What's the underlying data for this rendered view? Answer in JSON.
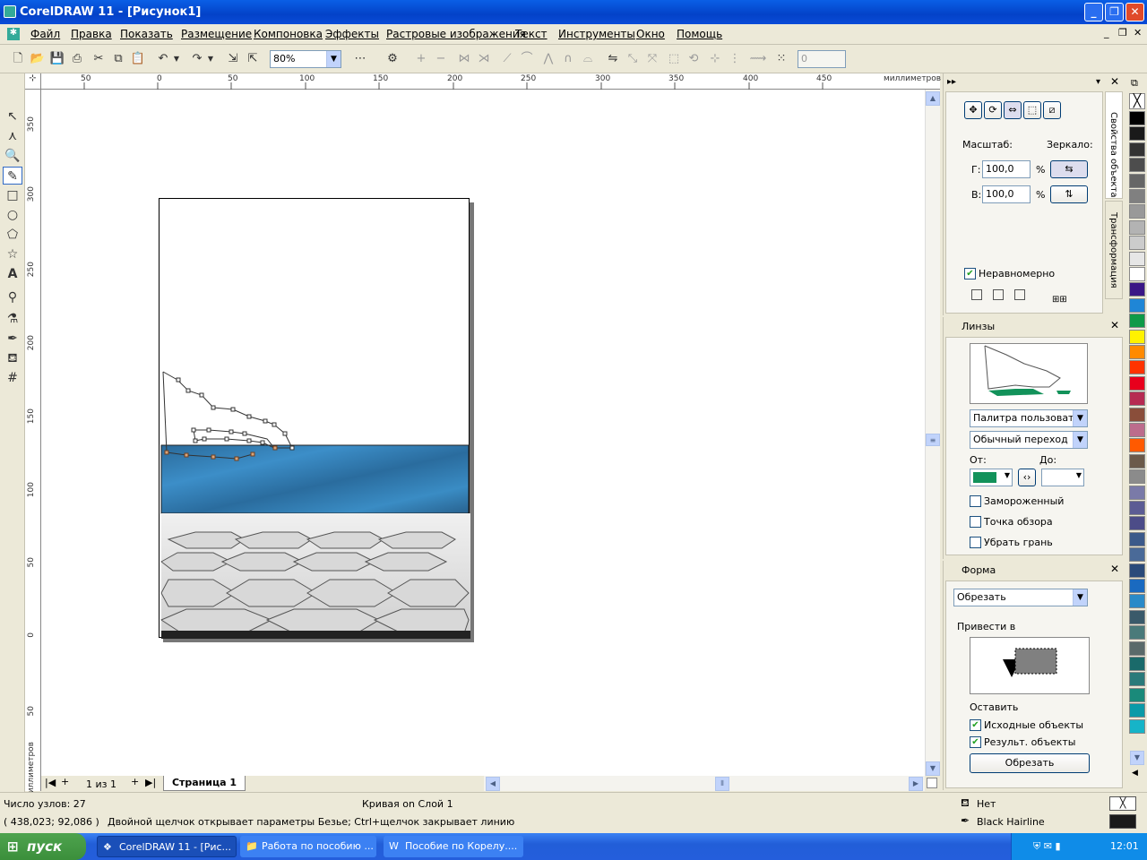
{
  "window": {
    "title": "CorelDRAW 11 - [Рисунок1]"
  },
  "menu": [
    "Файл",
    "Правка",
    "Показать",
    "Размещение",
    "Компоновка",
    "Эффекты",
    "Растровые изображения",
    "Текст",
    "Инструменты",
    "Окно",
    "Помощь"
  ],
  "toolbar": {
    "zoom": "80%",
    "nudge": "0"
  },
  "ruler": {
    "h_ticks": [
      "50",
      "0",
      "50",
      "100",
      "150",
      "200",
      "250",
      "300",
      "350",
      "400",
      "450"
    ],
    "h_unit": "миллиметров",
    "v_ticks": [
      "350",
      "300",
      "250",
      "200",
      "150",
      "100",
      "50",
      "0",
      "50"
    ],
    "v_unit": "миллиметров"
  },
  "pagenav": {
    "count": "1 из 1",
    "tab": "Страница 1"
  },
  "docker_obj": {
    "scale_label": "Масштаб:",
    "mirror_label": "Зеркало:",
    "h_label": "Г:",
    "h_value": "100,0",
    "v_label": "В:",
    "v_value": "100,0",
    "pct": "%",
    "nonprop": "Неравномерно",
    "tab1": "Свойства объекта",
    "tab2": "Трансформация"
  },
  "lens": {
    "title": "Линзы",
    "palette": "Палитра пользоват...",
    "transition": "Обычный переход",
    "from": "От:",
    "to": "До:",
    "frozen": "Замороженный",
    "viewpoint": "Точка обзора",
    "remove_face": "Убрать грань",
    "from_color": "#12925a"
  },
  "shape": {
    "title": "Форма",
    "mode": "Обрезать",
    "apply_to": "Привести в",
    "leave": "Оставить",
    "src": "Исходные объекты",
    "result": "Результ. объекты",
    "button": "Обрезать"
  },
  "status": {
    "nodes": "Число узлов: 27",
    "object": "Кривая on Слой 1",
    "coords": "( 438,023; 92,086 )",
    "hint": "Двойной щелчок открывает параметры Безье; Ctrl+щелчок закрывает линию",
    "fill": "Нет",
    "outline": "Black  Hairline"
  },
  "taskbar": {
    "start": "пуск",
    "tasks": [
      "CorelDRAW 11 - [Рис...",
      "Работа по пособию ...",
      "Пособие по Корелу...."
    ],
    "lang": "EN",
    "time": "12:01"
  },
  "palette": [
    "#ffffff",
    "#000000",
    "#1a1a1a",
    "#333333",
    "#4d4d4d",
    "#666666",
    "#808080",
    "#999999",
    "#b3b3b3",
    "#cccccc",
    "#e6e6e6",
    "#ffffff",
    "#3a1686",
    "#1f86d6",
    "#0f9a48",
    "#fff200",
    "#ff8a00",
    "#ff3300",
    "#e8001c",
    "#b62b52",
    "#8a4e3a",
    "#bc6c8c",
    "#ff5a00",
    "#6b5a4a",
    "#8b8b8b",
    "#7a7aa8",
    "#5c5c94",
    "#4c4c88",
    "#3c5a8a",
    "#4a6a98",
    "#2a4a7a",
    "#1a6ac0",
    "#2a8ac8",
    "#3a5a6a",
    "#4a7a7a",
    "#5a6a6a",
    "#1a6a6a",
    "#2a7a7a",
    "#1a8a7a",
    "#0a9aa8",
    "#16b4c8"
  ]
}
